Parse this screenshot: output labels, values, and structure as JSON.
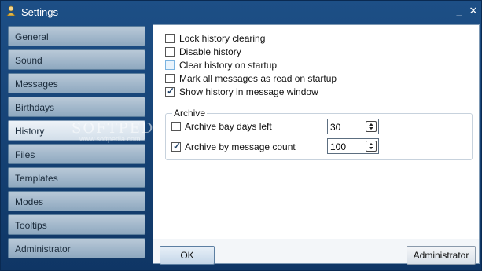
{
  "window": {
    "title": "Settings",
    "icon": "user-icon"
  },
  "sidebar": {
    "items": [
      {
        "label": "General",
        "active": false
      },
      {
        "label": "Sound",
        "active": false
      },
      {
        "label": "Messages",
        "active": false
      },
      {
        "label": "Birthdays",
        "active": false
      },
      {
        "label": "History",
        "active": true
      },
      {
        "label": "Files",
        "active": false
      },
      {
        "label": "Templates",
        "active": false
      },
      {
        "label": "Modes",
        "active": false
      },
      {
        "label": "Tooltips",
        "active": false
      },
      {
        "label": "Administrator",
        "active": false
      }
    ]
  },
  "history": {
    "options": [
      {
        "label": "Lock history clearing",
        "checked": false
      },
      {
        "label": "Disable history",
        "checked": false
      },
      {
        "label": "Clear history on startup",
        "checked": false
      },
      {
        "label": "Mark all messages as read on startup",
        "checked": false
      },
      {
        "label": "Show history in message window",
        "checked": true
      }
    ],
    "archive": {
      "legend": "Archive",
      "by_days": {
        "label": "Archive bay days left",
        "checked": false,
        "value": "30"
      },
      "by_count": {
        "label": "Archive by message count",
        "checked": true,
        "value": "100"
      }
    }
  },
  "buttons": {
    "ok": "OK",
    "administrator": "Administrator"
  },
  "watermark": {
    "text": "SOFTPEDIA",
    "url": "www.softpedia.com"
  }
}
